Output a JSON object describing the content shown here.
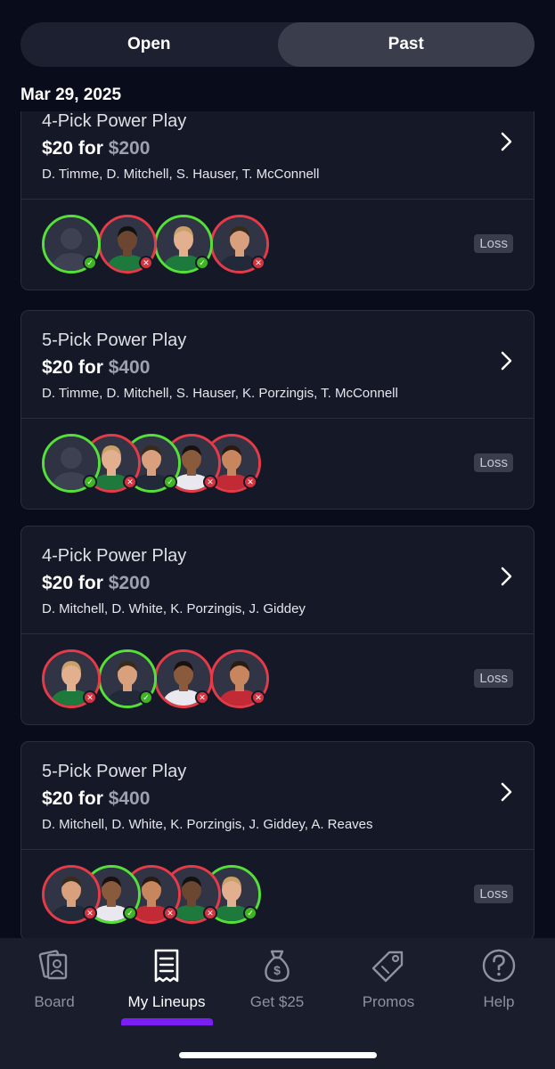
{
  "segment": {
    "open_label": "Open",
    "past_label": "Past",
    "selected": "Past"
  },
  "date_header": "Mar 29, 2025",
  "cards": [
    {
      "title": "4-Pick Power Play",
      "price_prefix": "$20 for ",
      "price_amount": "$200",
      "players": "D. Timme, D. Mitchell, S. Hauser, T. McConnell",
      "result": "Loss",
      "picks": [
        "win",
        "loss",
        "win",
        "loss"
      ]
    },
    {
      "title": "5-Pick Power Play",
      "price_prefix": "$20 for ",
      "price_amount": "$400",
      "players": "D. Timme, D. Mitchell, S. Hauser, K. Porzingis, T. McConnell",
      "result": "Loss",
      "picks": [
        "win",
        "loss",
        "win",
        "loss",
        "loss"
      ]
    },
    {
      "title": "4-Pick Power Play",
      "price_prefix": "$20 for ",
      "price_amount": "$200",
      "players": "D. Mitchell, D. White, K. Porzingis, J. Giddey",
      "result": "Loss",
      "picks": [
        "loss",
        "win",
        "loss",
        "loss"
      ]
    },
    {
      "title": "5-Pick Power Play",
      "price_prefix": "$20 for ",
      "price_amount": "$400",
      "players": "D. Mitchell, D. White, K. Porzingis, J. Giddey, A. Reaves",
      "result": "Loss",
      "picks": [
        "loss",
        "win",
        "loss",
        "loss",
        "win"
      ]
    }
  ],
  "tabs": [
    {
      "label": "Board",
      "icon": "board-cards-icon"
    },
    {
      "label": "My Lineups",
      "icon": "receipt-icon",
      "active": true
    },
    {
      "label": "Get $25",
      "icon": "money-bag-icon"
    },
    {
      "label": "Promos",
      "icon": "price-tag-icon"
    },
    {
      "label": "Help",
      "icon": "help-circle-icon"
    }
  ],
  "colors": {
    "background": "#090c1b",
    "win": "#55e039",
    "loss": "#e53b48",
    "accent": "#7a1ef3"
  }
}
